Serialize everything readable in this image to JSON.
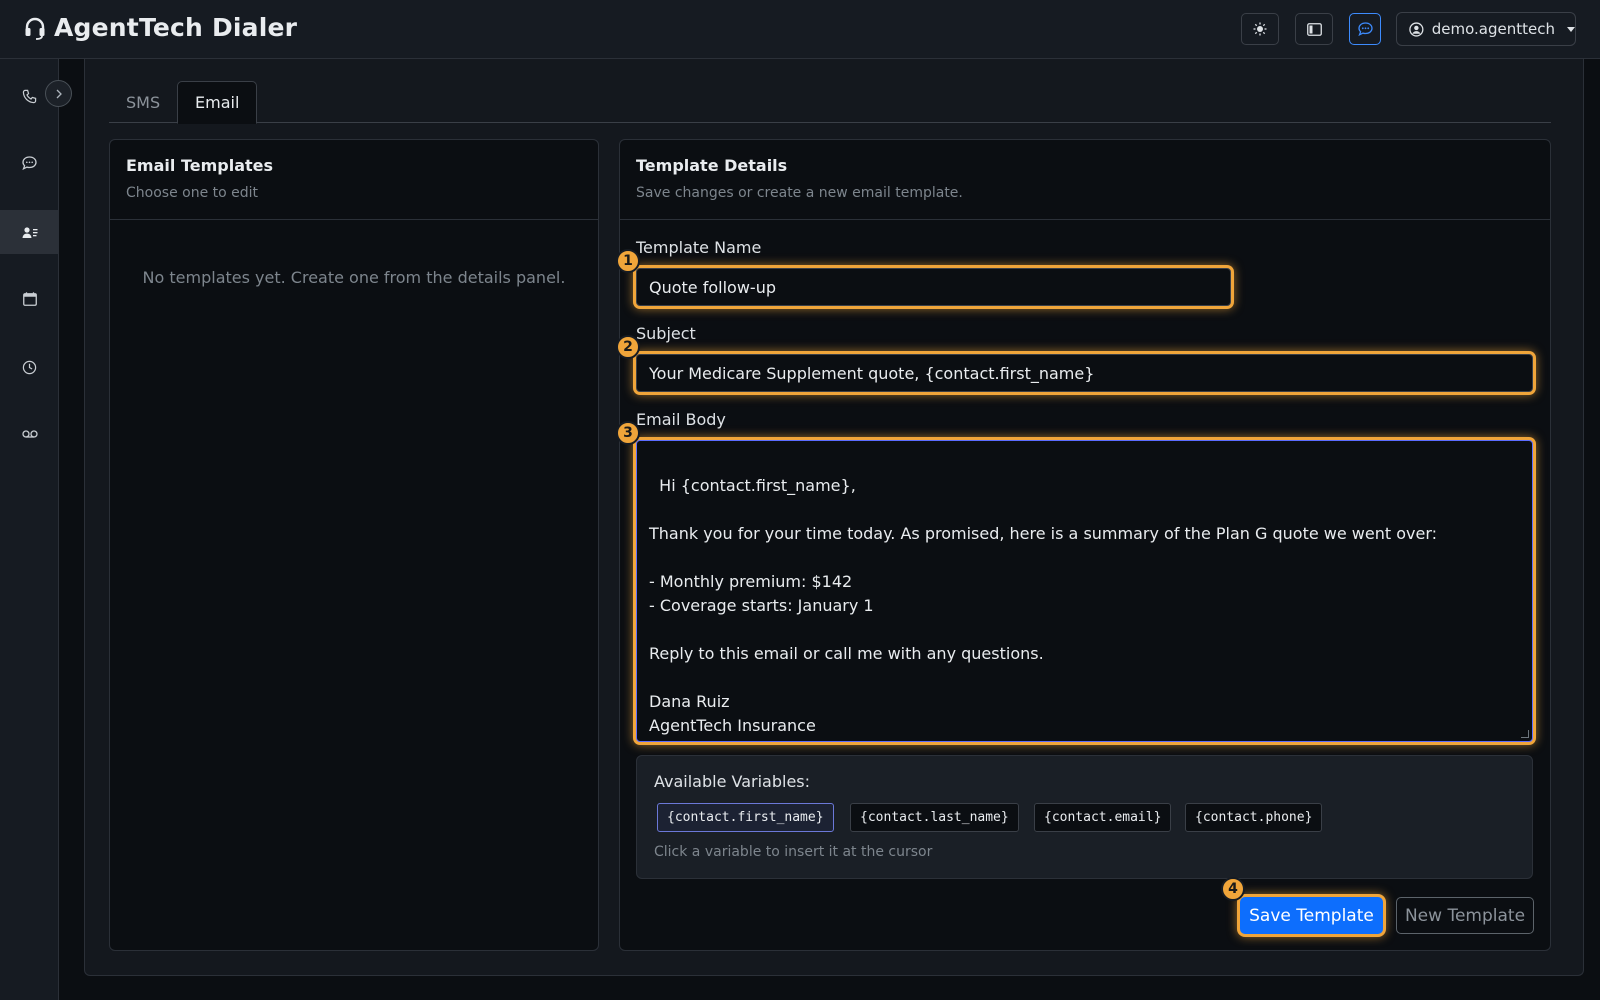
{
  "app": {
    "title": "AgentTech Dialer"
  },
  "header": {
    "user_label": "demo.agenttech",
    "buttons": [
      "theme-toggle",
      "layout-toggle",
      "chat-toggle"
    ]
  },
  "sidebar": {
    "items": [
      {
        "icon": "phone-icon"
      },
      {
        "icon": "message-icon"
      },
      {
        "icon": "contacts-icon",
        "active": true
      },
      {
        "icon": "calendar-icon"
      },
      {
        "icon": "history-icon"
      },
      {
        "icon": "voicemail-icon"
      }
    ]
  },
  "tabs": [
    {
      "label": "SMS",
      "active": false
    },
    {
      "label": "Email",
      "active": true
    }
  ],
  "templates_panel": {
    "title": "Email Templates",
    "subtitle": "Choose one to edit",
    "empty_message": "No templates yet. Create one from the details panel."
  },
  "details_panel": {
    "title": "Template Details",
    "subtitle": "Save changes or create a new email template.",
    "name_label": "Template Name",
    "name_value": "Quote follow-up",
    "subject_label": "Subject",
    "subject_value": "Your Medicare Supplement quote, {contact.first_name}",
    "body_label": "Email Body",
    "body_value": "Hi {contact.first_name},\n\nThank you for your time today. As promised, here is a summary of the Plan G quote we went over:\n\n- Monthly premium: $142\n- Coverage starts: January 1\n\nReply to this email or call me with any questions.\n\nDana Ruiz\nAgentTech Insurance",
    "variables_title": "Available Variables:",
    "variables": [
      "{contact.first_name}",
      "{contact.last_name}",
      "{contact.email}",
      "{contact.phone}"
    ],
    "variables_hint": "Click a variable to insert it at the cursor",
    "save_label": "Save Template",
    "new_label": "New Template"
  },
  "annotations": [
    "1",
    "2",
    "3",
    "4"
  ],
  "colors": {
    "accent": "#0d6efd",
    "highlight": "#f0a53a",
    "background": "#0b0e12"
  }
}
